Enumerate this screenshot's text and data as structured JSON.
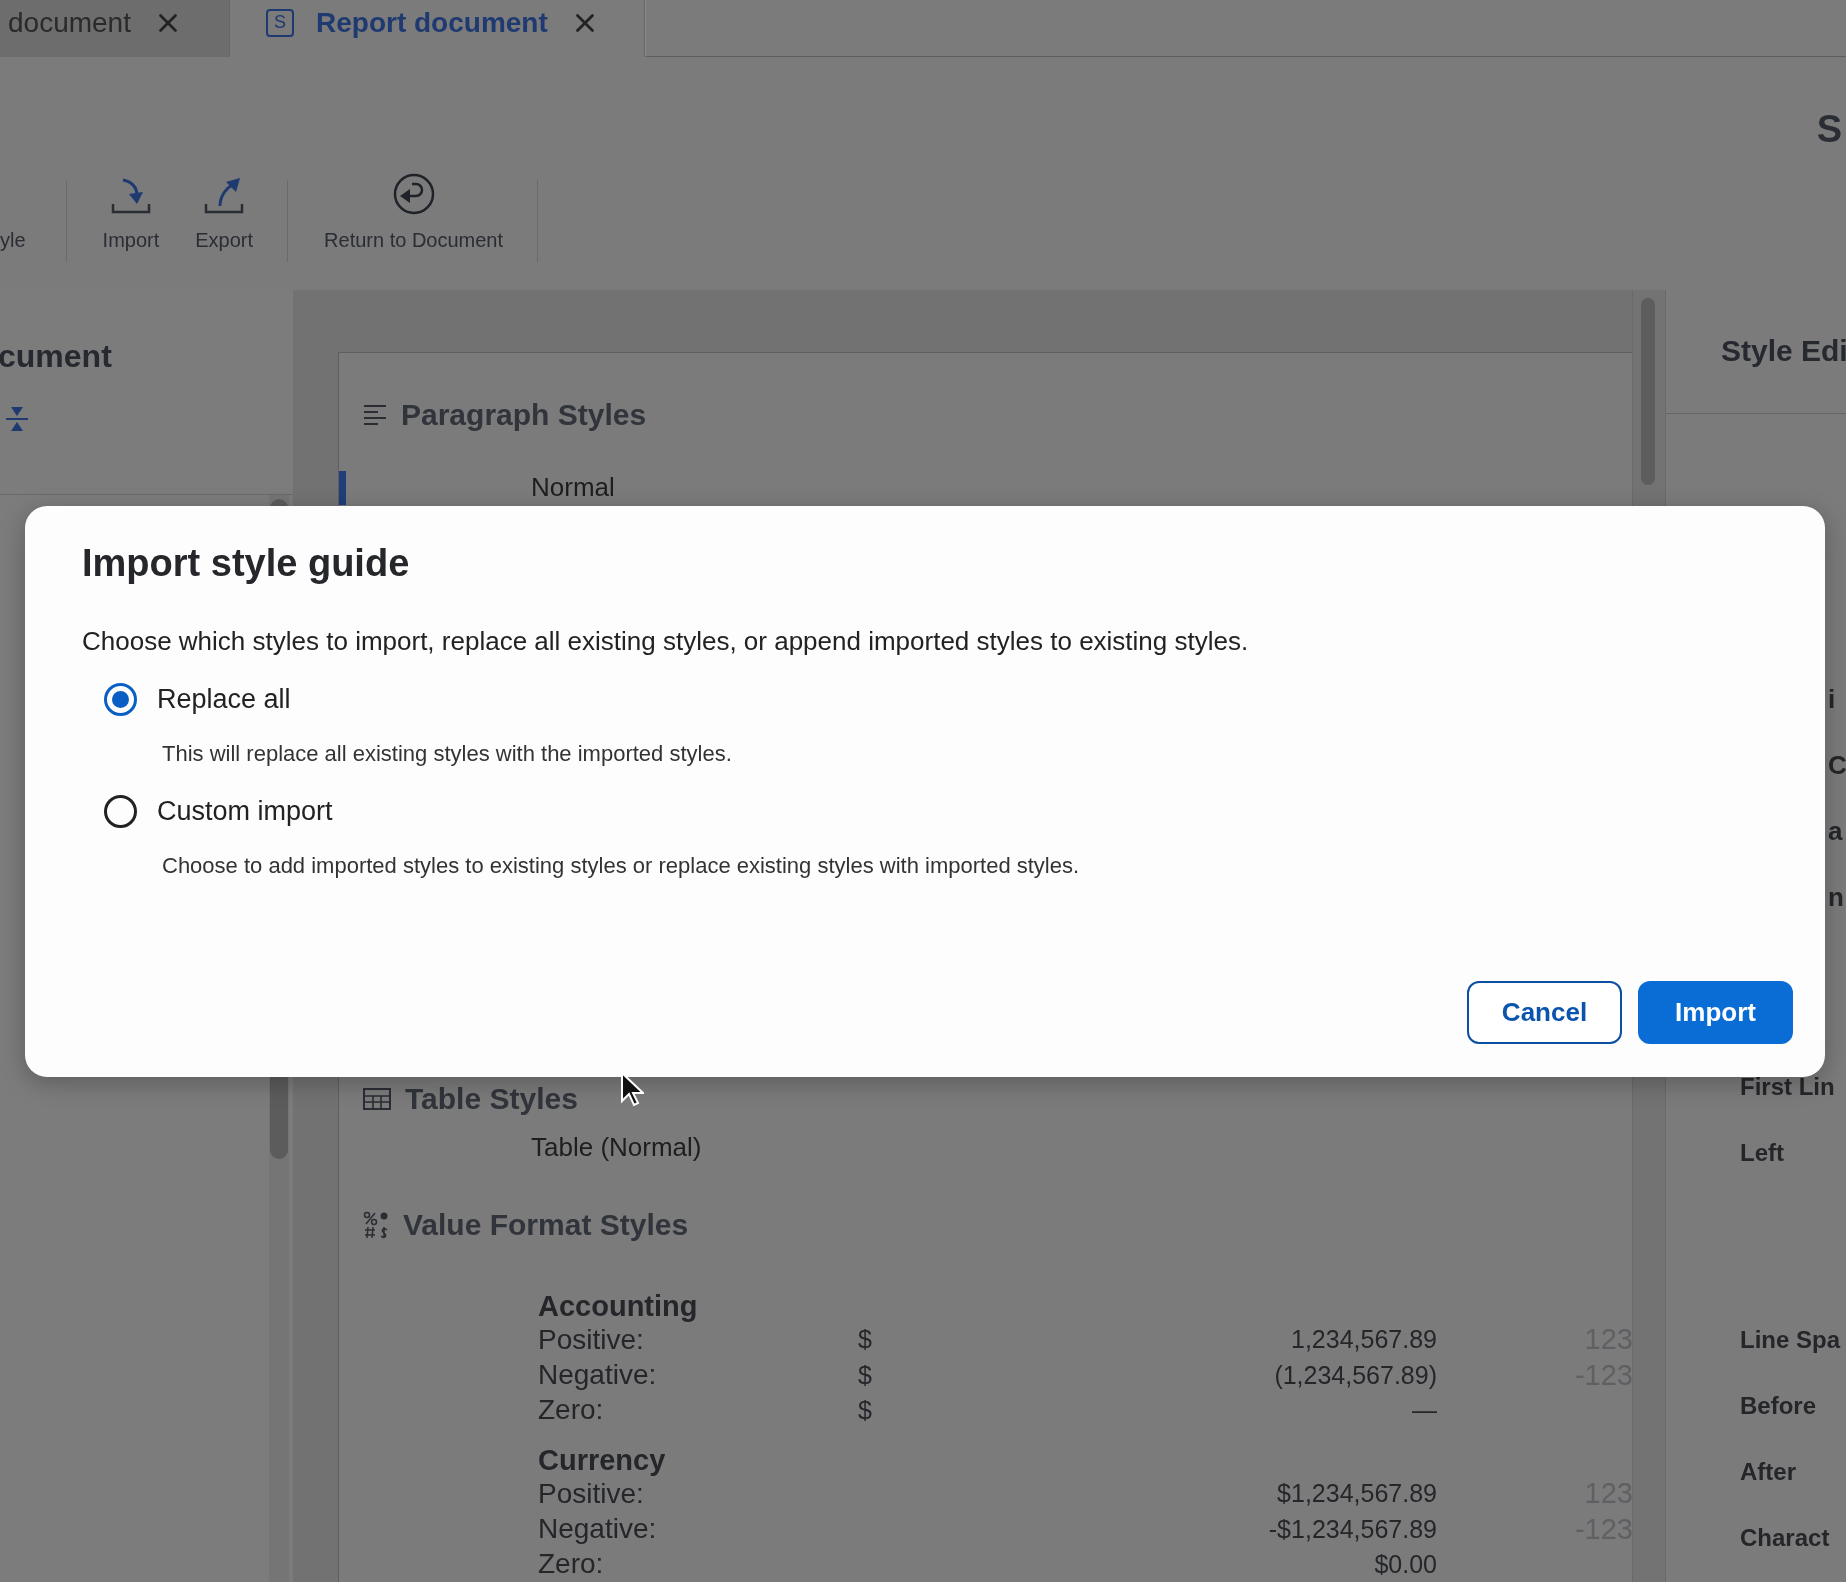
{
  "tabs": [
    {
      "label": "document",
      "selected": false
    },
    {
      "label": "Report document",
      "selected": true,
      "icon_letter": "S"
    }
  ],
  "toolbar": {
    "partial_label": "yle",
    "groups": [
      [
        {
          "label": "Import",
          "kind": "import"
        },
        {
          "label": "Export",
          "kind": "export"
        }
      ],
      [
        {
          "label": "Return to Document",
          "kind": "return"
        }
      ]
    ],
    "edge_text": "S"
  },
  "left_panel": {
    "title": "cument"
  },
  "paragraph_styles": {
    "title": "Paragraph Styles",
    "items": [
      {
        "label": "Normal",
        "selected": true
      }
    ]
  },
  "table_styles": {
    "title": "Table Styles",
    "items": [
      {
        "label": "Table (Normal)"
      }
    ]
  },
  "value_format_styles": {
    "title": "Value Format Styles",
    "groups": [
      {
        "name": "Accounting",
        "rows": [
          {
            "label": "Positive:",
            "symbol": "$",
            "value": "1,234,567.89",
            "sample": "123"
          },
          {
            "label": "Negative:",
            "symbol": "$",
            "value": "(1,234,567.89)",
            "sample": "-123"
          },
          {
            "label": "Zero:",
            "symbol": "$",
            "value": "—"
          }
        ]
      },
      {
        "name": "Currency",
        "rows": [
          {
            "label": "Positive:",
            "value": "$1,234,567.89",
            "sample": "123"
          },
          {
            "label": "Negative:",
            "value": "-$1,234,567.89",
            "sample": "-123"
          },
          {
            "label": "Zero:",
            "value": "$0.00"
          }
        ]
      }
    ]
  },
  "style_editor": {
    "title": "Style Edi",
    "fragments": [
      "i",
      "C",
      "a",
      "n"
    ],
    "labels": [
      "First Lin",
      "Left",
      "Line Spa",
      "Before",
      "After",
      "Charact"
    ]
  },
  "dialog": {
    "title": "Import style guide",
    "description": "Choose which styles to import, replace all existing styles, or append imported styles to existing styles.",
    "options": [
      {
        "label": "Replace all",
        "help": "This will replace all existing styles with the imported styles.",
        "selected": true
      },
      {
        "label": "Custom import",
        "help": "Choose to add imported styles to existing styles or replace existing styles with imported styles.",
        "selected": false
      }
    ],
    "buttons": [
      {
        "label": "Cancel",
        "kind": "secondary"
      },
      {
        "label": "Import",
        "kind": "primary"
      }
    ]
  }
}
